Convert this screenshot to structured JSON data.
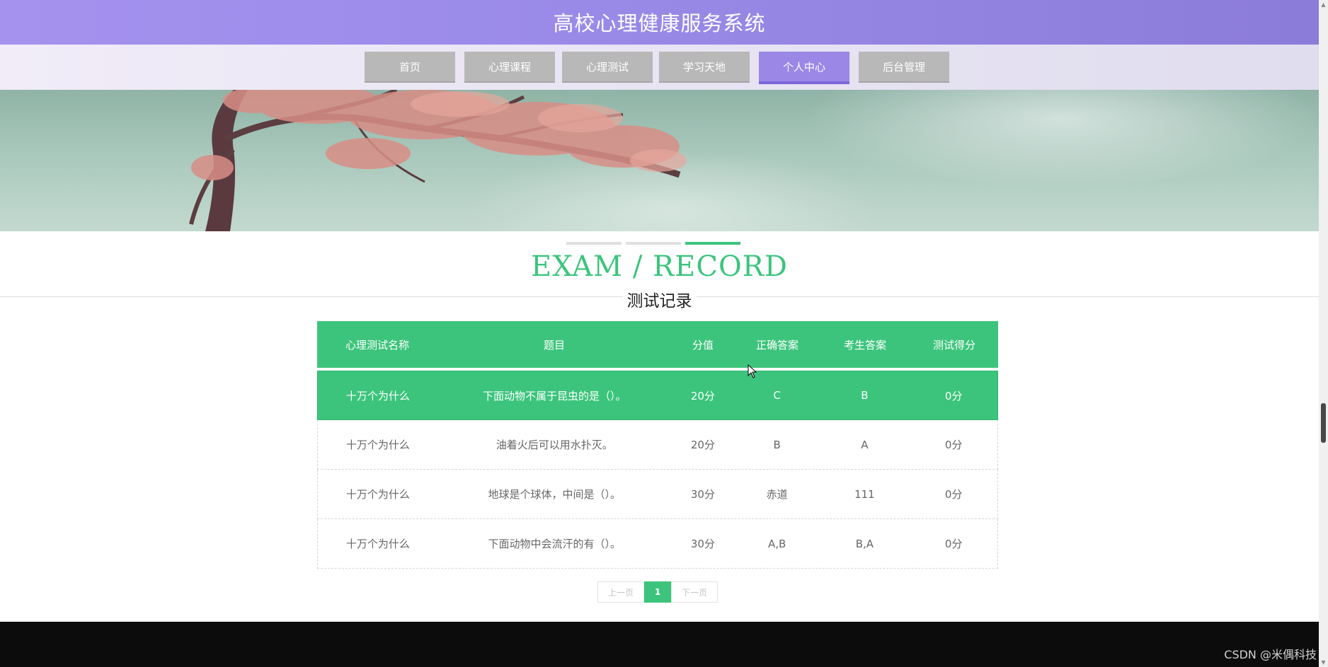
{
  "header": {
    "title": "高校心理健康服务系统"
  },
  "nav": {
    "items": [
      {
        "label": "首页"
      },
      {
        "label": "心理课程"
      },
      {
        "label": "心理测试"
      },
      {
        "label": "学习天地"
      },
      {
        "label": "个人中心"
      },
      {
        "label": "后台管理"
      }
    ],
    "active": "个人中心"
  },
  "section": {
    "title_en": "EXAM / RECORD",
    "title_cn": "测试记录"
  },
  "table": {
    "headers": [
      "心理测试名称",
      "题目",
      "分值",
      "正确答案",
      "考生答案",
      "测试得分"
    ],
    "rows": [
      [
        "十万个为什么",
        "下面动物不属于昆虫的是（）。",
        "20分",
        "C",
        "B",
        "0分"
      ],
      [
        "十万个为什么",
        "油着火后可以用水扑灭。",
        "20分",
        "B",
        "A",
        "0分"
      ],
      [
        "十万个为什么",
        "地球是个球体，中间是（）。",
        "30分",
        "赤道",
        "111",
        "0分"
      ],
      [
        "十万个为什么",
        "下面动物中会流汗的有（）。",
        "30分",
        "A,B",
        "B,A",
        "0分"
      ]
    ]
  },
  "pagination": {
    "prev": "上一页",
    "current": "1",
    "next": "下一页"
  },
  "watermark": "CSDN @米偶科技",
  "colors": {
    "accent_green": "#3cc47c",
    "header_purple": "#9b87e6",
    "nav_gray": "#b8b8b8",
    "footer": "#0c0c0c"
  }
}
